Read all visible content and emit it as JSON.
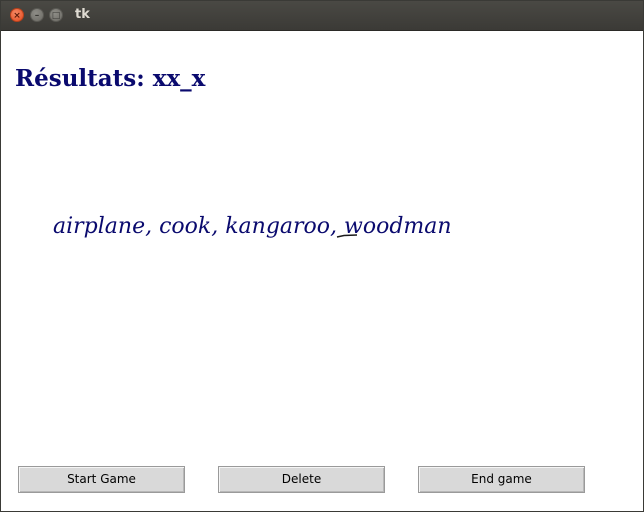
{
  "window": {
    "title": "tk",
    "close_glyph": "×",
    "minimize_glyph": "–",
    "maximize_glyph": "□"
  },
  "main": {
    "results_label": "Résultats: xx_x",
    "words_text": "airplane, cook, kangaroo, woodman"
  },
  "buttons": {
    "start_label": "Start Game",
    "delete_label": "Delete",
    "end_label": "End game"
  },
  "colors": {
    "text_primary": "#0a0a6e",
    "button_bg": "#d9d9d9",
    "titlebar_bg": "#3b3a36",
    "close_button": "#e2491d"
  }
}
